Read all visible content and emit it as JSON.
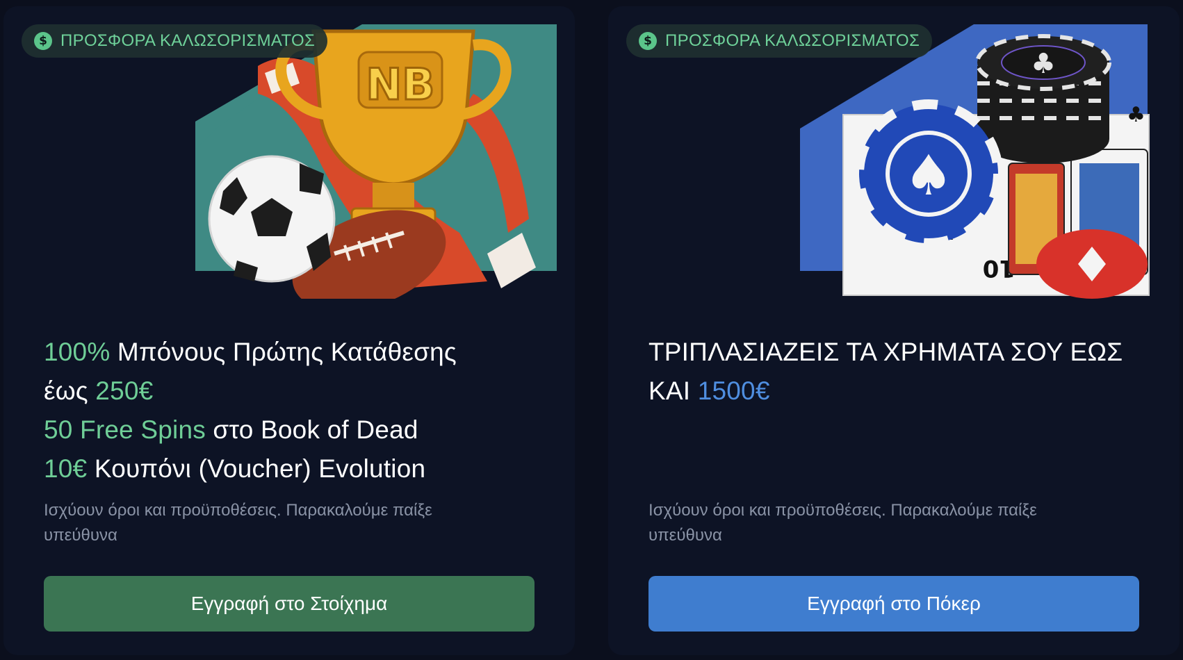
{
  "cards": [
    {
      "badge": "ΠΡΟΣΦΟΡΑ ΚΑΛΩΣΟΡΙΣΜΑΤΟΣ",
      "badge_icon": "dollar-icon",
      "art_icon": "sports-trophy-art",
      "lines": [
        {
          "accent": "100%",
          "text": " Μπόνους Πρώτης Κατάθεσης"
        },
        {
          "text": "έως ",
          "accent": "250€"
        },
        {
          "accent": "50 Free Spins",
          "text": " στο Book of Dead"
        },
        {
          "accent": "10€",
          "text": " Κουπόνι (Voucher) Evolution"
        }
      ],
      "terms": "Ισχύουν όροι και προϋποθέσεις. Παρακαλούμε παίξε υπεύθυνα",
      "cta": "Εγγραφή στο Στοίχημα",
      "accent_color": "#6fce97",
      "button_color": "#3b7553"
    },
    {
      "badge": "ΠΡΟΣΦΟΡΑ ΚΑΛΩΣΟΡΙΣΜΑΤΟΣ",
      "badge_icon": "dollar-icon",
      "art_icon": "poker-chips-art",
      "lines": [
        {
          "text": "ΤΡΙΠΛΑΣΙΑΖΕΙΣ ΤΑ ΧΡΗΜΑΤΑ ΣΟΥ ΕΩΣ"
        },
        {
          "text": "ΚΑΙ ",
          "accent": "1500€"
        }
      ],
      "terms": "Ισχύουν όροι και προϋποθέσεις. Παρακαλούμε παίξε υπεύθυνα",
      "cta": "Εγγραφή στο Πόκερ",
      "accent_color": "#4f8ee0",
      "button_color": "#3f7dcf"
    }
  ]
}
